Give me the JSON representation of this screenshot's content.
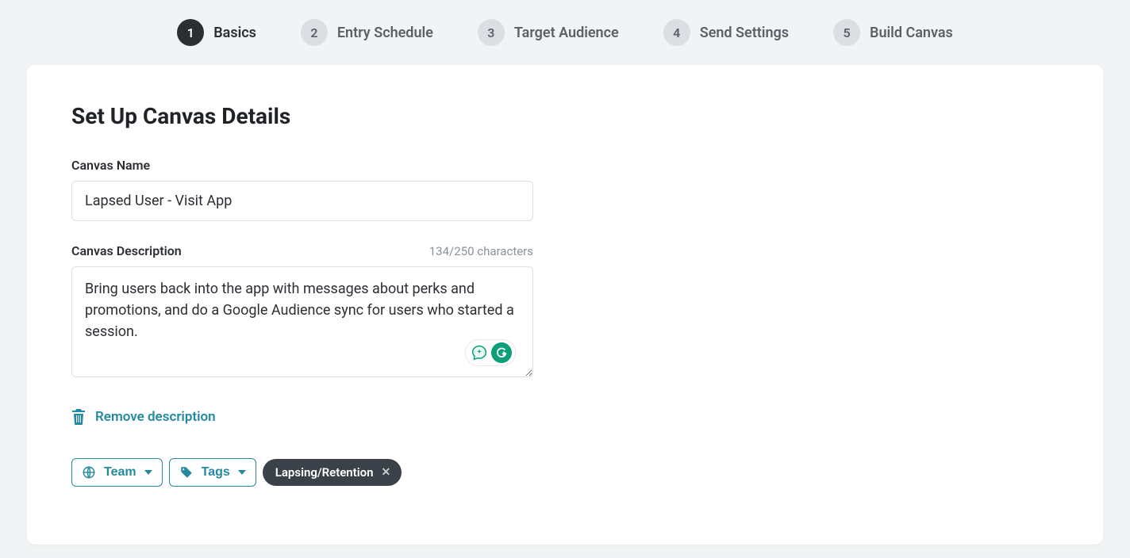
{
  "stepper": {
    "steps": [
      {
        "num": "1",
        "label": "Basics",
        "active": true
      },
      {
        "num": "2",
        "label": "Entry Schedule",
        "active": false
      },
      {
        "num": "3",
        "label": "Target Audience",
        "active": false
      },
      {
        "num": "4",
        "label": "Send Settings",
        "active": false
      },
      {
        "num": "5",
        "label": "Build Canvas",
        "active": false
      }
    ]
  },
  "page": {
    "title": "Set Up Canvas Details"
  },
  "form": {
    "name_label": "Canvas Name",
    "name_value": "Lapsed User - Visit App",
    "desc_label": "Canvas Description",
    "desc_count": "134/250 characters",
    "desc_value": "Bring users back into the app with messages about perks and promotions, and do a Google Audience sync for users who started a session.",
    "remove_label": "Remove description",
    "team_label": "Team",
    "tags_label": "Tags",
    "tag_chip": "Lapsing/Retention"
  },
  "colors": {
    "accent": "#248a9f",
    "dark": "#2b2f33",
    "chip": "#3a4148",
    "grammarly": "#0d9e7a"
  }
}
